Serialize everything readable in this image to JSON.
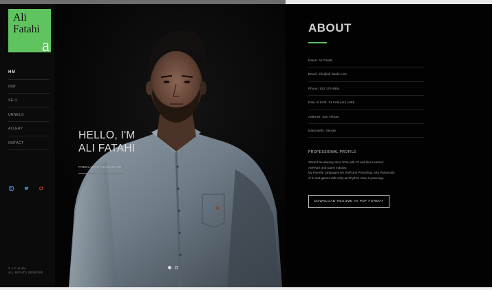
{
  "logo": {
    "first_name": "Ali",
    "last_name": "Fatahi",
    "mark": "a"
  },
  "nav": {
    "items": [
      {
        "label": "HM",
        "active": true
      },
      {
        "label": "ONT",
        "active": false
      },
      {
        "label": "SE II",
        "active": false
      },
      {
        "label": "URNELS",
        "active": false
      },
      {
        "label": "ALLERY",
        "active": false
      },
      {
        "label": "ONTACT",
        "active": false
      }
    ]
  },
  "social": {
    "icons": [
      {
        "name": "instagram-icon",
        "color": "#3b7bbf"
      },
      {
        "name": "twitter-icon",
        "color": "#3aa6dc"
      },
      {
        "name": "google-plus-icon",
        "color": "#c94a3b"
      }
    ]
  },
  "copyright": {
    "line1": "© A F at ahi",
    "line2": "ALL RIGHTS RESERVE"
  },
  "hero": {
    "greeting_line1": "HELLO, I'M",
    "greeting_line2": "ALI FATAHI",
    "role": "FREELANCE DEVELOPER",
    "slides_total": 2,
    "slide_active": 1
  },
  "about": {
    "title": "ABOUT",
    "info": [
      "Name: Ali Fatahi",
      "Email: info@ali fatahi.com",
      "Phone: 912 179 9854",
      "Date of birth: 31 February 1999",
      "Address: Iran Tehran",
      "Nationality: Iranian"
    ],
    "profile_title": "PROFESSIONAL PROFILE",
    "profile_lines": [
      "Started Developing since 2016 with C# and then Learned",
      "ASP.NET and Game Industry.",
      "My Favorite Languages are Swift and Photoshop, also Passionate",
      "of IU and games with Unity and Python since 2 years ago."
    ],
    "download_label": "DOWNLOAD RESUME AS PDF FORMAT"
  },
  "colors": {
    "accent": "#5fc45f",
    "background": "#050505",
    "text": "#cfcfcf"
  }
}
